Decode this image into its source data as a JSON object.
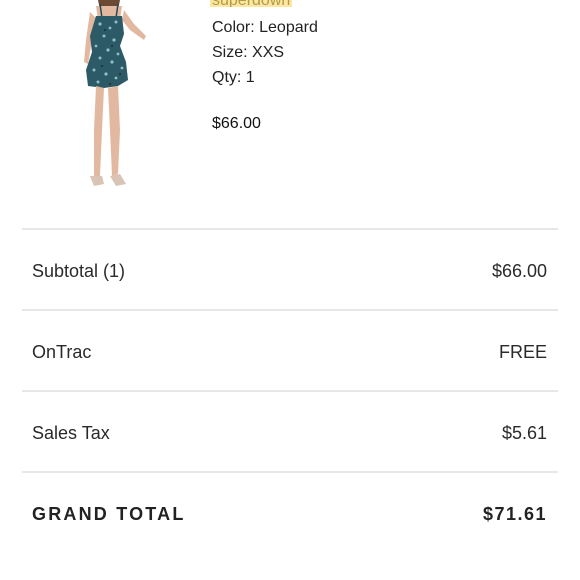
{
  "product": {
    "brand": "superdown",
    "color": "Color: Leopard",
    "size": "Size: XXS",
    "qty": "Qty: 1",
    "price": "$66.00"
  },
  "summary": {
    "rows": [
      {
        "label": "Subtotal (1)",
        "value": "$66.00"
      },
      {
        "label": "OnTrac",
        "value": "FREE"
      },
      {
        "label": "Sales Tax",
        "value": "$5.61"
      }
    ],
    "grand_total": {
      "label": "GRAND TOTAL",
      "value": "$71.61"
    }
  },
  "colors": {
    "brand_highlight": "#fbe7a4",
    "divider": "#e7e7e7",
    "dress_teal": "#2c5a66"
  }
}
